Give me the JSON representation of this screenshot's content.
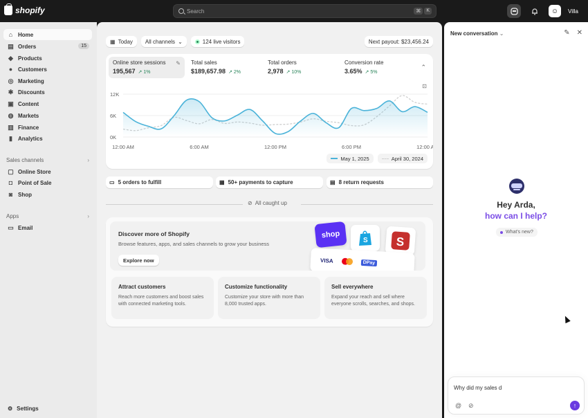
{
  "topbar": {
    "brand": "shopify",
    "search_placeholder": "Search",
    "kbd": [
      "⌘",
      "K"
    ],
    "user_initials": "☺",
    "user_name": "Villa"
  },
  "sidebar": {
    "items": [
      {
        "label": "Home",
        "icon": "home-icon",
        "glyph": "⌂"
      },
      {
        "label": "Orders",
        "icon": "orders-icon",
        "glyph": "▤",
        "badge": "15"
      },
      {
        "label": "Products",
        "icon": "tag-icon",
        "glyph": "◆"
      },
      {
        "label": "Customers",
        "icon": "person-icon",
        "glyph": "●"
      },
      {
        "label": "Marketing",
        "icon": "target-icon",
        "glyph": "◎"
      },
      {
        "label": "Discounts",
        "icon": "discount-icon",
        "glyph": "✱"
      },
      {
        "label": "Content",
        "icon": "content-icon",
        "glyph": "▣"
      },
      {
        "label": "Markets",
        "icon": "globe-icon",
        "glyph": "◍"
      },
      {
        "label": "Finance",
        "icon": "bank-icon",
        "glyph": "▥"
      },
      {
        "label": "Analytics",
        "icon": "chart-icon",
        "glyph": "▮"
      }
    ],
    "sales_channels_label": "Sales channels",
    "channels": [
      {
        "label": "Online Store",
        "icon": "store-icon",
        "glyph": "▢"
      },
      {
        "label": "Point of Sale",
        "icon": "pos-icon",
        "glyph": "◘"
      },
      {
        "label": "Shop",
        "icon": "shop-icon",
        "glyph": "◙"
      }
    ],
    "apps_label": "Apps",
    "apps": [
      {
        "label": "Email",
        "icon": "email-icon",
        "glyph": "▭"
      }
    ],
    "settings_label": "Settings"
  },
  "filters": {
    "date": "Today",
    "channels": "All channels",
    "visitors": "124 live visitors",
    "payout": "Next payout: $23,456.24"
  },
  "metrics": [
    {
      "label": "Online store sessions",
      "value": "195,567",
      "change": "1%"
    },
    {
      "label": "Total sales",
      "value": "$189,657.98",
      "change": "2%"
    },
    {
      "label": "Total orders",
      "value": "2,978",
      "change": "10%"
    },
    {
      "label": "Conversion rate",
      "value": "3.65%",
      "change": "5%"
    }
  ],
  "chart_data": {
    "type": "line",
    "x": [
      "12:00 AM",
      "1:00 AM",
      "2:00 AM",
      "3:00 AM",
      "4:00 AM",
      "5:00 AM",
      "6:00 AM",
      "7:00 AM",
      "8:00 AM",
      "9:00 AM",
      "10:00 AM",
      "11:00 AM",
      "12:00 PM",
      "1:00 PM",
      "2:00 PM",
      "3:00 PM",
      "4:00 PM",
      "5:00 PM",
      "6:00 PM",
      "7:00 PM",
      "8:00 PM",
      "9:00 PM",
      "10:00 PM",
      "11:00 PM",
      "12:00 AM"
    ],
    "x_tick_labels": [
      "12:00 AM",
      "6:00 AM",
      "12:00 PM",
      "6:00 PM",
      "12:00 AM"
    ],
    "y_tick_labels": [
      "12K",
      "6K",
      "0K"
    ],
    "ylim": [
      0,
      12000
    ],
    "series": [
      {
        "name": "May 1, 2025",
        "color": "#4bb3d9",
        "values": [
          6900,
          4300,
          3000,
          2300,
          5900,
          10300,
          9900,
          5400,
          4500,
          6100,
          7700,
          4500,
          1000,
          1500,
          4500,
          6600,
          4000,
          2600,
          8000,
          7400,
          8000,
          10100,
          7100,
          8500,
          6900
        ]
      },
      {
        "name": "April 30, 2024",
        "color": "#cfcfcf",
        "values": [
          2200,
          1800,
          2600,
          3200,
          5500,
          4600,
          3700,
          4900,
          3800,
          4200,
          3900,
          3300,
          3500,
          3600,
          4200,
          5100,
          4400,
          4000,
          3200,
          3400,
          5700,
          8700,
          11600,
          9700,
          9200
        ]
      }
    ]
  },
  "tasks": [
    {
      "label": "5 orders to fulfill",
      "icon": "inbox-icon",
      "glyph": "▭"
    },
    {
      "label": "50+ payments to capture",
      "icon": "money-icon",
      "glyph": "▦"
    },
    {
      "label": "8 return requests",
      "icon": "return-icon",
      "glyph": "▤"
    }
  ],
  "caught_up": "All caught up",
  "discover": {
    "title": "Discover more of Shopify",
    "subtitle": "Browse features, apps, and sales channels to grow your business",
    "button": "Explore now",
    "tile_shop": "shop",
    "tile_visa": "VISA",
    "tile_dpay": "DPay",
    "cards": [
      {
        "title": "Attract customers",
        "desc": "Reach more customers and boost sales with connected marketing tools."
      },
      {
        "title": "Customize functionality",
        "desc": "Customize your store with more than 8,000 trusted apps."
      },
      {
        "title": "Sell everywhere",
        "desc": "Expand your reach and sell where everyone scrolls, searches, and shops."
      }
    ]
  },
  "panel": {
    "title": "New conversation",
    "greeting_1": "Hey Arda,",
    "greeting_2": "how can I help?",
    "whats_new": "What's new?",
    "input_value": "Why did my sales d"
  },
  "colors": {
    "accent_purple": "#7b4de6",
    "chart_blue": "#4bb3d9",
    "success_green": "#29845a",
    "topbar": "#1a1a1a"
  }
}
